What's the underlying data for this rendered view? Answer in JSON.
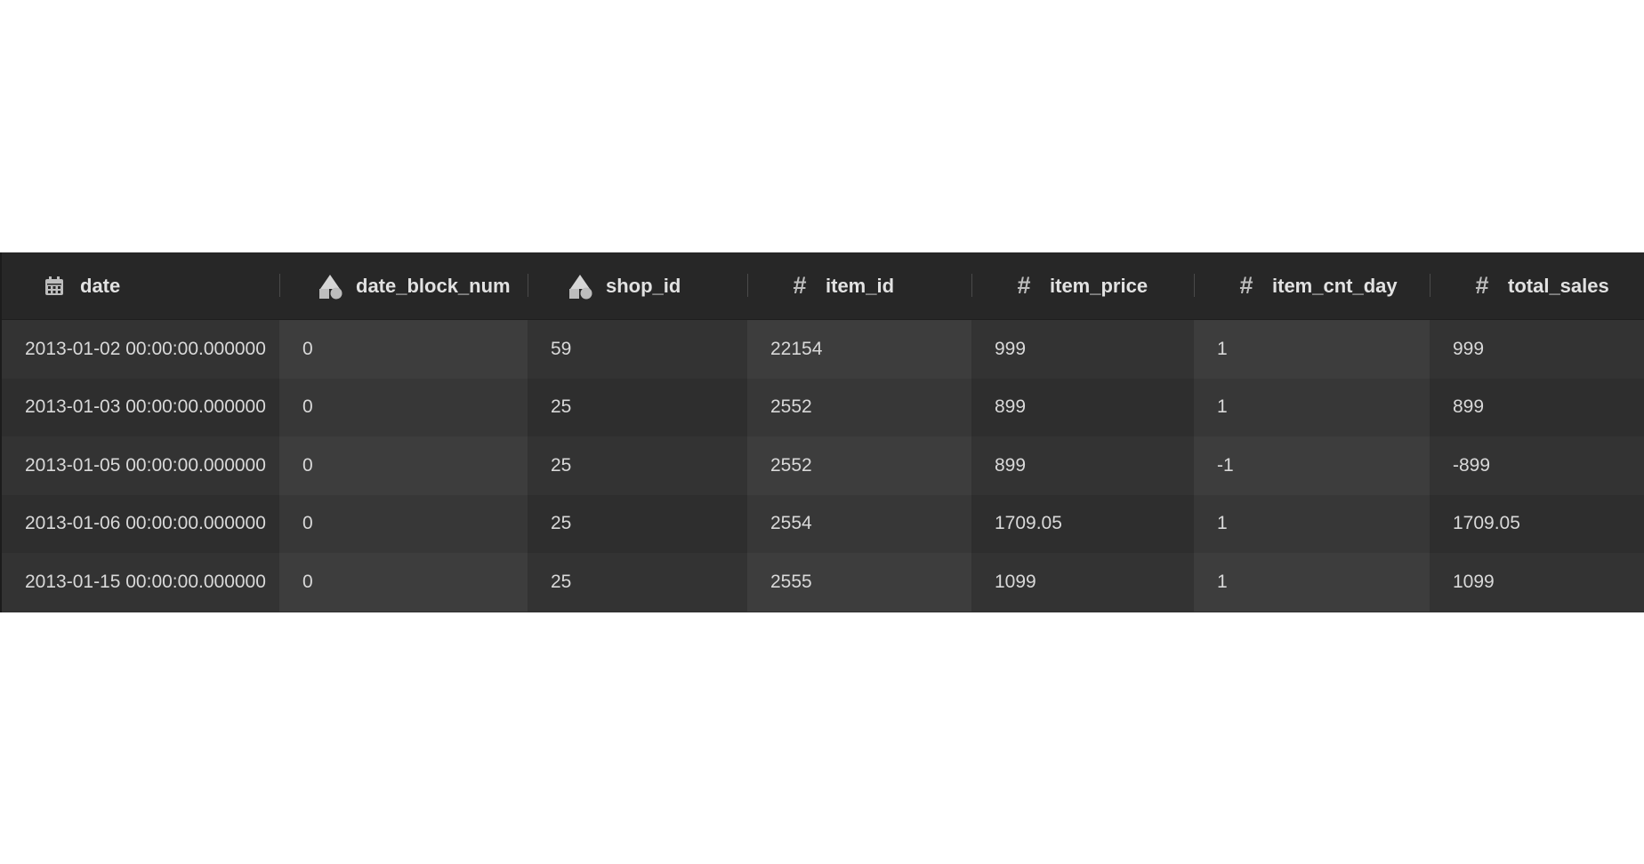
{
  "table": {
    "columns": [
      {
        "label": "date",
        "icon": "calendar-icon"
      },
      {
        "label": "date_block_num",
        "icon": "shapes-icon"
      },
      {
        "label": "shop_id",
        "icon": "shapes-icon"
      },
      {
        "label": "item_id",
        "icon": "hash-icon"
      },
      {
        "label": "item_price",
        "icon": "hash-icon"
      },
      {
        "label": "item_cnt_day",
        "icon": "hash-icon"
      },
      {
        "label": "total_sales",
        "icon": "hash-icon"
      }
    ],
    "rows": [
      [
        "2013-01-02 00:00:00.000000",
        "0",
        "59",
        "22154",
        "999",
        "1",
        "999"
      ],
      [
        "2013-01-03 00:00:00.000000",
        "0",
        "25",
        "2552",
        "899",
        "1",
        "899"
      ],
      [
        "2013-01-05 00:00:00.000000",
        "0",
        "25",
        "2552",
        "899",
        "-1",
        "-899"
      ],
      [
        "2013-01-06 00:00:00.000000",
        "0",
        "25",
        "2554",
        "1709.05",
        "1",
        "1709.05"
      ],
      [
        "2013-01-15 00:00:00.000000",
        "0",
        "25",
        "2555",
        "1099",
        "1",
        "1099"
      ]
    ]
  },
  "colors": {
    "header_bg": "#272727",
    "cell_dark": "#333333",
    "cell_light": "#3d3d3d",
    "text": "#d9d9d9"
  }
}
